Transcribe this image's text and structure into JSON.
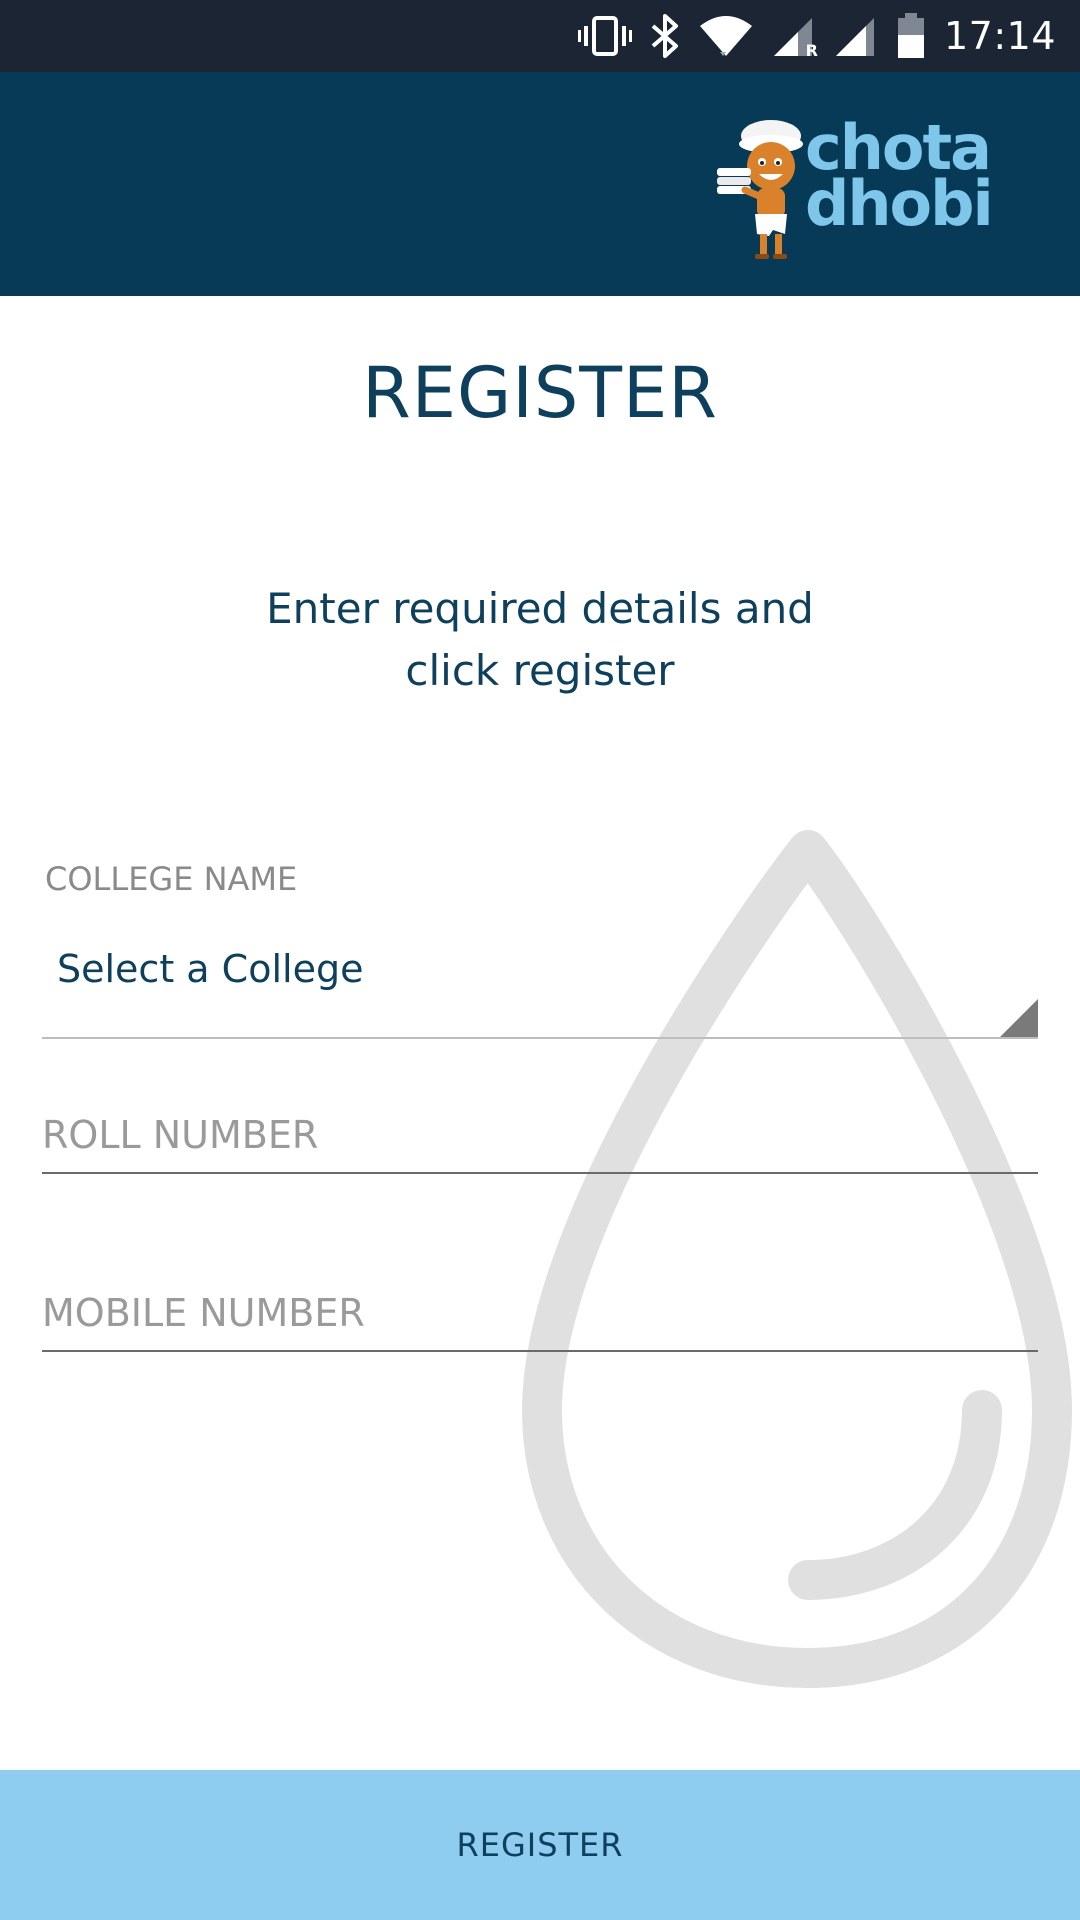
{
  "status_bar": {
    "time": "17:14",
    "icons": [
      "vibrate-icon",
      "bluetooth-icon",
      "wifi-icon",
      "signal-roaming-icon",
      "signal-icon",
      "battery-icon"
    ],
    "roaming_badge": "R"
  },
  "header": {
    "logo_text_line1": "chota",
    "logo_text_line2": "dhobi",
    "logo_icon": "chota-dhobi-mascot-icon"
  },
  "main": {
    "title": "REGISTER",
    "instructions_line1": "Enter required details and",
    "instructions_line2": "click register"
  },
  "form": {
    "college_label": "COLLEGE NAME",
    "college_selected": "Select a College",
    "roll_placeholder": "ROLL NUMBER",
    "mobile_placeholder": "MOBILE NUMBER",
    "submit_label": "REGISTER"
  },
  "colors": {
    "status_bar": "#1b2533",
    "header": "#063a57",
    "brand_text": "#7fc7ea",
    "primary_text": "#0e3f5c",
    "button": "#8ecdf0",
    "watermark": "#e0e0e0"
  }
}
